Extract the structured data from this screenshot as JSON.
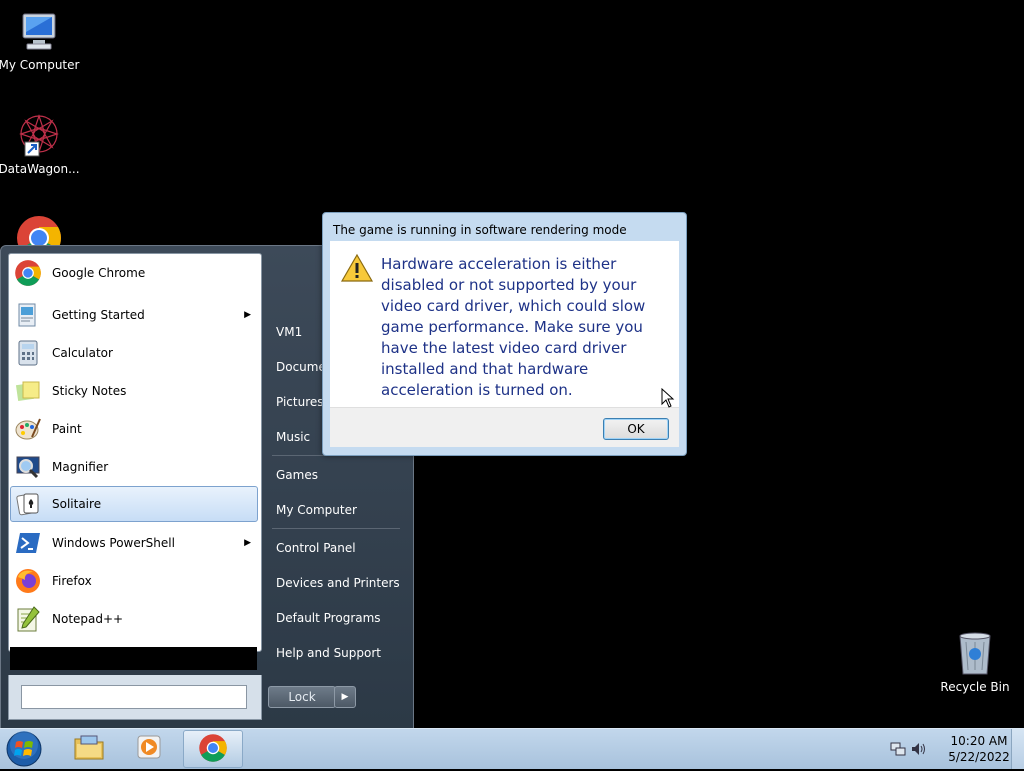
{
  "desktop": {
    "icons": [
      {
        "label": "My Computer",
        "icon": "my-computer-icon"
      },
      {
        "label": "DataWagon...",
        "icon": "datawagon-icon"
      },
      {
        "label": "Recycle Bin",
        "icon": "recycle-bin-icon"
      }
    ]
  },
  "start_menu": {
    "programs": [
      {
        "label": "Google Chrome",
        "icon": "chrome-icon"
      },
      {
        "label": "Getting Started",
        "icon": "getting-started-icon"
      },
      {
        "label": "Calculator",
        "icon": "calculator-icon"
      },
      {
        "label": "Sticky Notes",
        "icon": "sticky-notes-icon"
      },
      {
        "label": "Paint",
        "icon": "paint-icon"
      },
      {
        "label": "Magnifier",
        "icon": "magnifier-icon"
      },
      {
        "label": "Solitaire",
        "icon": "solitaire-icon"
      },
      {
        "label": "Windows PowerShell",
        "icon": "powershell-icon"
      },
      {
        "label": "Firefox",
        "icon": "firefox-icon"
      },
      {
        "label": "Notepad++",
        "icon": "notepadpp-icon"
      }
    ],
    "search_placeholder": "",
    "right_items": [
      {
        "label": "VM1"
      },
      {
        "label": "Documents"
      },
      {
        "label": "Pictures"
      },
      {
        "label": "Music"
      },
      {
        "label": "Games"
      },
      {
        "label": "My Computer"
      },
      {
        "label": "Control Panel"
      },
      {
        "label": "Devices and Printers"
      },
      {
        "label": "Default Programs"
      },
      {
        "label": "Help and Support"
      }
    ],
    "lock_label": "Lock"
  },
  "dialog": {
    "title": "The game is running in software rendering mode",
    "message": "Hardware acceleration is either disabled or not supported by your video card driver, which could slow game performance. Make sure you have the latest video card driver installed and that hardware acceleration is turned on.",
    "ok_label": "OK"
  },
  "taskbar": {
    "clock_time": "10:20 AM",
    "clock_date": "5/22/2022"
  },
  "colors": {
    "dialog_text": "#1e3287",
    "taskbar": "#b5cce3",
    "selection": "#c7ddf6"
  }
}
